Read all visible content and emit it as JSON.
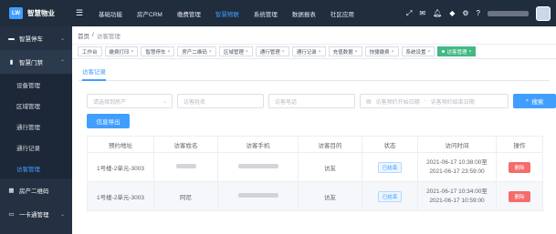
{
  "header": {
    "logo_mark": "LW",
    "app_name": "智慧物业",
    "nav": [
      "基础功能",
      "房产CRM",
      "缴费管理",
      "智慧物联",
      "系统管理",
      "数据报表",
      "社区应用"
    ],
    "active_nav_index": 3,
    "icons": [
      "fullscreen-icon",
      "mail-icon",
      "bell-icon",
      "layers-icon",
      "settings-icon",
      "help-icon"
    ],
    "accent": "#409eff"
  },
  "sidebar": {
    "groups": [
      {
        "label": "智慧停车",
        "icon": "car-icon",
        "caret": "⌄"
      },
      {
        "label": "智慧门禁",
        "icon": "door-icon",
        "caret": "⌃"
      }
    ],
    "items": [
      "设备管理",
      "区域管理",
      "通行管理",
      "通行记录",
      "访客管理"
    ],
    "active_item_index": 4,
    "bottom_groups": [
      {
        "label": "房产二维码",
        "icon": "qrcode-icon",
        "caret": ""
      },
      {
        "label": "一卡通管理",
        "icon": "card-icon",
        "caret": "⌄"
      }
    ]
  },
  "breadcrumb": {
    "home": "首页",
    "separator": "/",
    "current": "访客管理"
  },
  "tags": [
    {
      "label": "工作台",
      "closable": false
    },
    {
      "label": "缴费打印",
      "closable": true
    },
    {
      "label": "智慧停车",
      "closable": true
    },
    {
      "label": "房产二维码",
      "closable": true
    },
    {
      "label": "区域管理",
      "closable": true
    },
    {
      "label": "通行管理",
      "closable": true
    },
    {
      "label": "通行记录",
      "closable": true
    },
    {
      "label": "充值数据",
      "closable": true
    },
    {
      "label": "快捷缴费",
      "closable": true
    },
    {
      "label": "系统设置",
      "closable": true
    },
    {
      "label": "访客管理",
      "closable": true,
      "active": true
    }
  ],
  "tab": {
    "label": "访客记录"
  },
  "filters": {
    "property_placeholder": "请选择到房产",
    "name_placeholder": "访客姓名",
    "phone_placeholder": "访客电话",
    "start_placeholder": "访客预约开始日期",
    "date_sep": "-",
    "end_placeholder": "访客预约结束日期",
    "search_label": "搜索",
    "export_label": "信息导出"
  },
  "table": {
    "columns": [
      "预约地址",
      "访客姓名",
      "访客手机",
      "访客目的",
      "状态",
      "访问时间",
      "操作"
    ],
    "rows": [
      {
        "address": "1号楼-2单元-3003",
        "name": "",
        "phone": "",
        "purpose": "访友",
        "status": "已结束",
        "time_start": "2021-06-17 10:38:00至",
        "time_end": "2021-06-17 23:59:00",
        "action": "删除"
      },
      {
        "address": "1号楼-2单元-3003",
        "name": "阿尼",
        "phone": "",
        "purpose": "访友",
        "status": "已结束",
        "time_start": "2021-06-17 10:34:00至",
        "time_end": "2021-06-17 10:59:00",
        "action": "删除"
      }
    ]
  }
}
